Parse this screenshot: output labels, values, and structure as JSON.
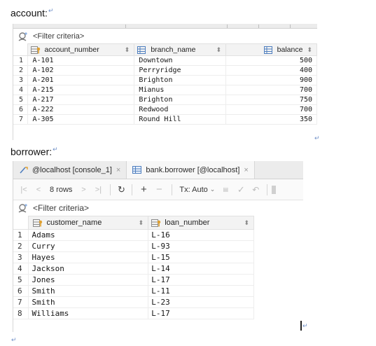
{
  "account_heading": "account:",
  "borrower_heading": "borrower:",
  "account_panel": {
    "filter_placeholder": "<Filter criteria>",
    "columns": [
      "account_number",
      "branch_name",
      "balance"
    ],
    "rows": [
      {
        "rownum": "1",
        "account_number": "A-101",
        "branch_name": "Downtown",
        "balance": "500"
      },
      {
        "rownum": "2",
        "account_number": "A-102",
        "branch_name": "Perryridge",
        "balance": "400"
      },
      {
        "rownum": "3",
        "account_number": "A-201",
        "branch_name": "Brighton",
        "balance": "900"
      },
      {
        "rownum": "4",
        "account_number": "A-215",
        "branch_name": "Mianus",
        "balance": "700"
      },
      {
        "rownum": "5",
        "account_number": "A-217",
        "branch_name": "Brighton",
        "balance": "750"
      },
      {
        "rownum": "6",
        "account_number": "A-222",
        "branch_name": "Redwood",
        "balance": "700"
      },
      {
        "rownum": "7",
        "account_number": "A-305",
        "branch_name": "Round Hill",
        "balance": "350"
      }
    ]
  },
  "borrower_panel": {
    "tabs": [
      {
        "label": "@localhost [console_1]",
        "icon": "console-icon",
        "active": false
      },
      {
        "label": "bank.borrower [@localhost]",
        "icon": "table-icon",
        "active": true
      }
    ],
    "toolbar": {
      "rows_label": "8 rows",
      "tx_label": "Tx: Auto"
    },
    "filter_placeholder": "<Filter criteria>",
    "columns": [
      "customer_name",
      "loan_number"
    ],
    "rows": [
      {
        "rownum": "1",
        "customer_name": "Adams",
        "loan_number": "L-16"
      },
      {
        "rownum": "2",
        "customer_name": "Curry",
        "loan_number": "L-93"
      },
      {
        "rownum": "3",
        "customer_name": "Hayes",
        "loan_number": "L-15"
      },
      {
        "rownum": "4",
        "customer_name": "Jackson",
        "loan_number": "L-14"
      },
      {
        "rownum": "5",
        "customer_name": "Jones",
        "loan_number": "L-17"
      },
      {
        "rownum": "6",
        "customer_name": "Smith",
        "loan_number": "L-11"
      },
      {
        "rownum": "7",
        "customer_name": "Smith",
        "loan_number": "L-23"
      },
      {
        "rownum": "8",
        "customer_name": "Williams",
        "loan_number": "L-17"
      }
    ]
  },
  "colors": {
    "paragraph_mark": "#6f8fc7",
    "key_icon": "#e0a030",
    "column_icon": "#4f7fbf",
    "header_bg": "#f3f3f3"
  }
}
